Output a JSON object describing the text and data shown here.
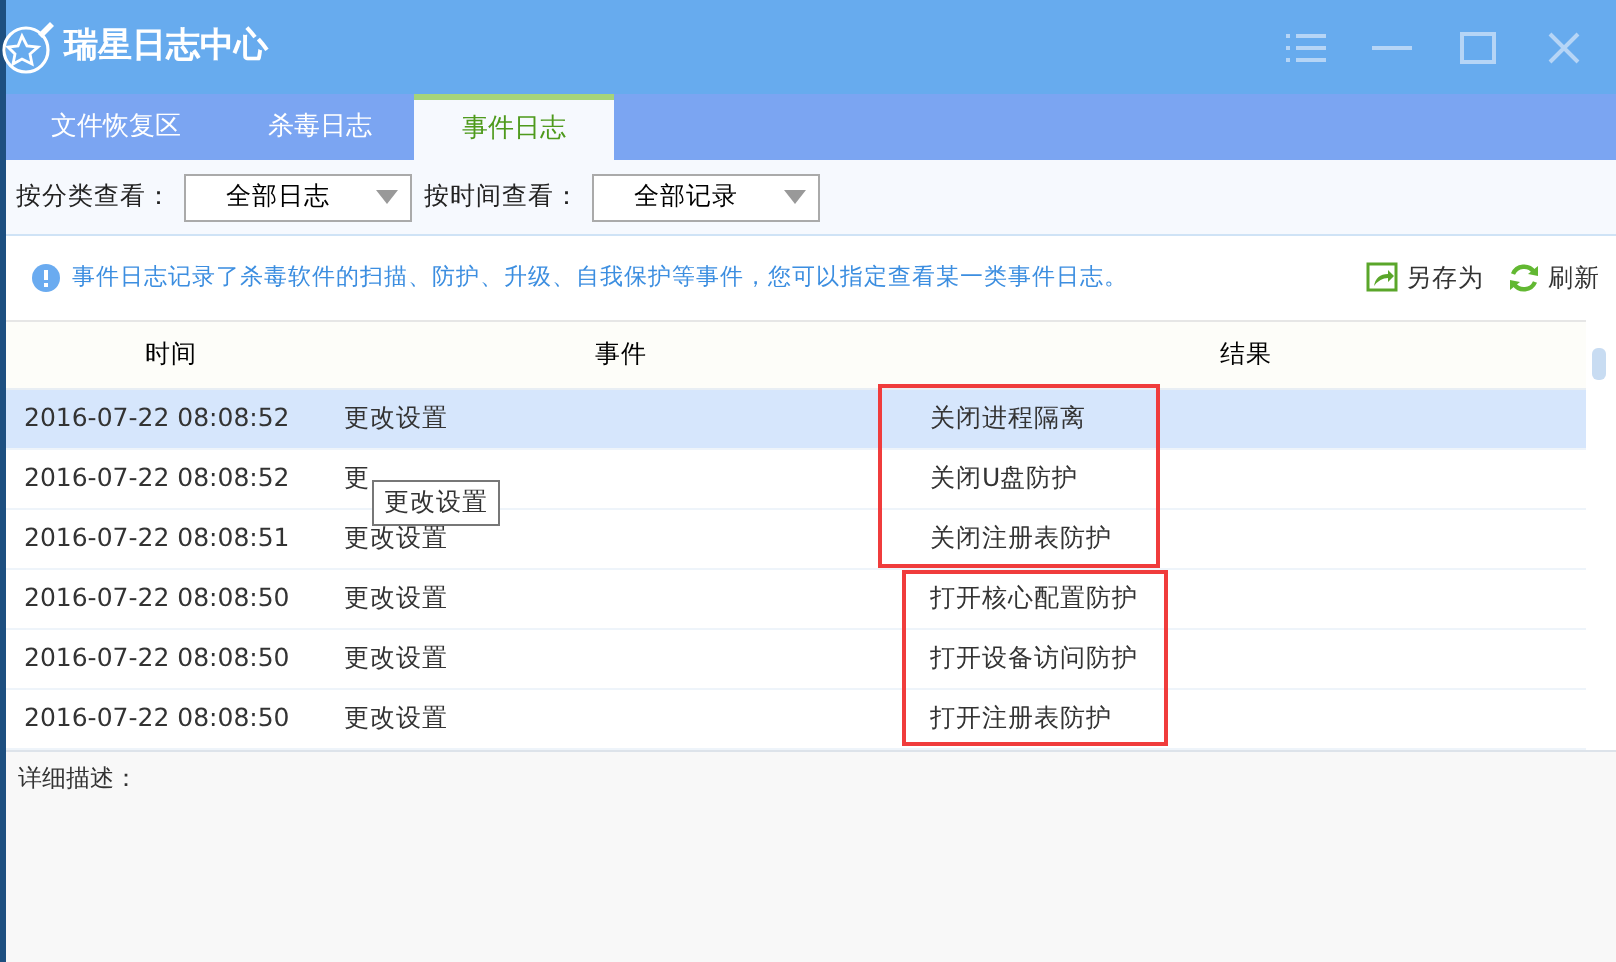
{
  "window": {
    "title": "瑞星日志中心"
  },
  "tabs": [
    {
      "label": "文件恢复区",
      "selected": false
    },
    {
      "label": "杀毒日志",
      "selected": false
    },
    {
      "label": "事件日志",
      "selected": true
    }
  ],
  "filters": [
    {
      "label": "按分类查看：",
      "value": "全部日志"
    },
    {
      "label": "按时间查看：",
      "value": "全部记录"
    }
  ],
  "info": "事件日志记录了杀毒软件的扫描、防护、升级、自我保护等事件，您可以指定查看某一类事件日志。",
  "actions": [
    {
      "kind": "save",
      "label": "另存为"
    },
    {
      "kind": "refresh",
      "label": "刷新"
    }
  ],
  "table": {
    "columns": [
      "时间",
      "事件",
      "结果"
    ],
    "rows": [
      {
        "time": "2016-07-22 08:08:52",
        "event": "更改设置",
        "result": "关闭进程隔离",
        "selected": true
      },
      {
        "time": "2016-07-22 08:08:52",
        "event": "更",
        "result": "关闭U盘防护",
        "selected": false
      },
      {
        "time": "2016-07-22 08:08:51",
        "event": "更改设置",
        "result": "关闭注册表防护",
        "selected": false
      },
      {
        "time": "2016-07-22 08:08:50",
        "event": "更改设置",
        "result": "打开核心配置防护",
        "selected": false
      },
      {
        "time": "2016-07-22 08:08:50",
        "event": "更改设置",
        "result": "打开设备访问防护",
        "selected": false
      },
      {
        "time": "2016-07-22 08:08:50",
        "event": "更改设置",
        "result": "打开注册表防护",
        "selected": false
      }
    ]
  },
  "tooltip": "更改设置",
  "details": {
    "label": "详细描述："
  }
}
